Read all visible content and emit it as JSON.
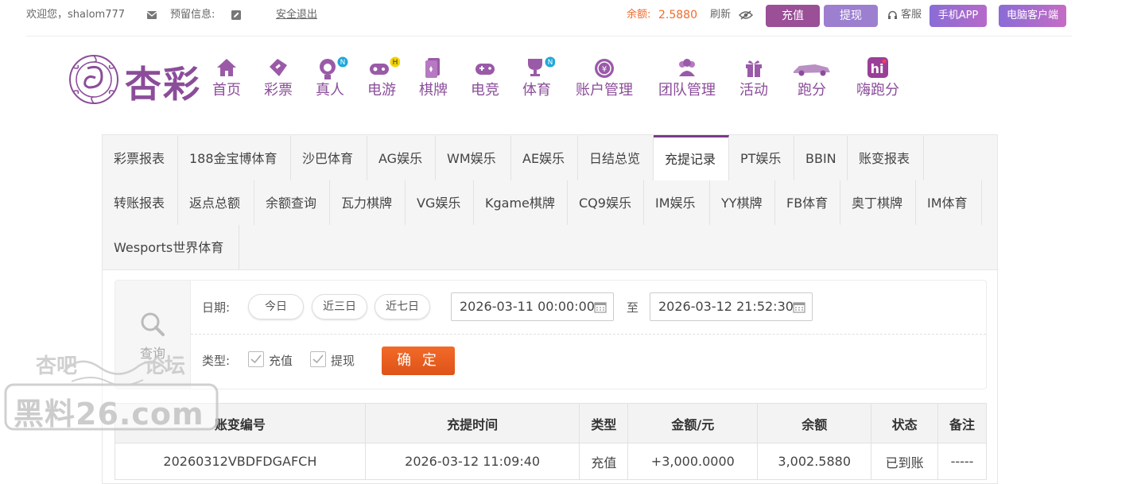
{
  "topbar": {
    "welcome": "欢迎您，shalom777",
    "reserved_info_label": "预留信息:",
    "logout": "安全退出",
    "balance_label": "余额:",
    "balance_value": "2.5880",
    "refresh": "刷新",
    "deposit": "充值",
    "withdraw": "提现",
    "service": "客服",
    "mobile_app": "手机APP",
    "pc_client": "电脑客户端"
  },
  "logo": {
    "text": "杏彩"
  },
  "nav": [
    {
      "label": "首页",
      "icon": "home-icon"
    },
    {
      "label": "彩票",
      "icon": "lottery-icon"
    },
    {
      "label": "真人",
      "icon": "live-dealer-icon",
      "badge": "N"
    },
    {
      "label": "电游",
      "icon": "slot-game-icon",
      "badge": "H"
    },
    {
      "label": "棋牌",
      "icon": "cards-icon"
    },
    {
      "label": "电竞",
      "icon": "esports-gamepad-icon"
    },
    {
      "label": "体育",
      "icon": "trophy-icon",
      "badge": "N"
    },
    {
      "label": "账户管理",
      "icon": "account-coin-icon"
    },
    {
      "label": "团队管理",
      "icon": "team-icon"
    },
    {
      "label": "活动",
      "icon": "gift-icon"
    },
    {
      "label": "跑分",
      "icon": "car-icon"
    },
    {
      "label": "嗨跑分",
      "icon": "hi-icon"
    }
  ],
  "tabs": [
    "彩票报表",
    "188金宝博体育",
    "沙巴体育",
    "AG娱乐",
    "WM娱乐",
    "AE娱乐",
    "日结总览",
    "充提记录",
    "PT娱乐",
    "BBIN",
    "账变报表",
    "转账报表",
    "返点总额",
    "余额查询",
    "瓦力棋牌",
    "VG娱乐",
    "Kgame棋牌",
    "CQ9娱乐",
    "IM娱乐",
    "YY棋牌",
    "FB体育",
    "奥丁棋牌",
    "IM体育",
    "Wesports世界体育"
  ],
  "active_tab": "充提记录",
  "query": {
    "side_label": "查询",
    "date_label": "日期:",
    "quick": [
      "今日",
      "近三日",
      "近七日"
    ],
    "date_from": "2026-03-11 00:00:00",
    "to_label": "至",
    "date_to": "2026-03-12 21:52:30",
    "type_label": "类型:",
    "type_deposit": "充值",
    "type_withdraw": "提现",
    "submit": "确 定"
  },
  "table": {
    "headers": [
      "账变编号",
      "充提时间",
      "类型",
      "金额/元",
      "余额",
      "状态",
      "备注"
    ],
    "rows": [
      [
        "20260312VBDFDGAFCH",
        "2026-03-12 11:09:40",
        "充值",
        "+3,000.0000",
        "3,002.5880",
        "已到账",
        "-----"
      ]
    ]
  },
  "watermark": {
    "line1": "杏吧",
    "line2": "论坛",
    "line3": "黑料26.com"
  },
  "colors": {
    "brand_purple": "#8b4d9a",
    "accent_orange": "#e55c21",
    "amount_red": "#d4242b",
    "status_green": "#2aa22a"
  }
}
